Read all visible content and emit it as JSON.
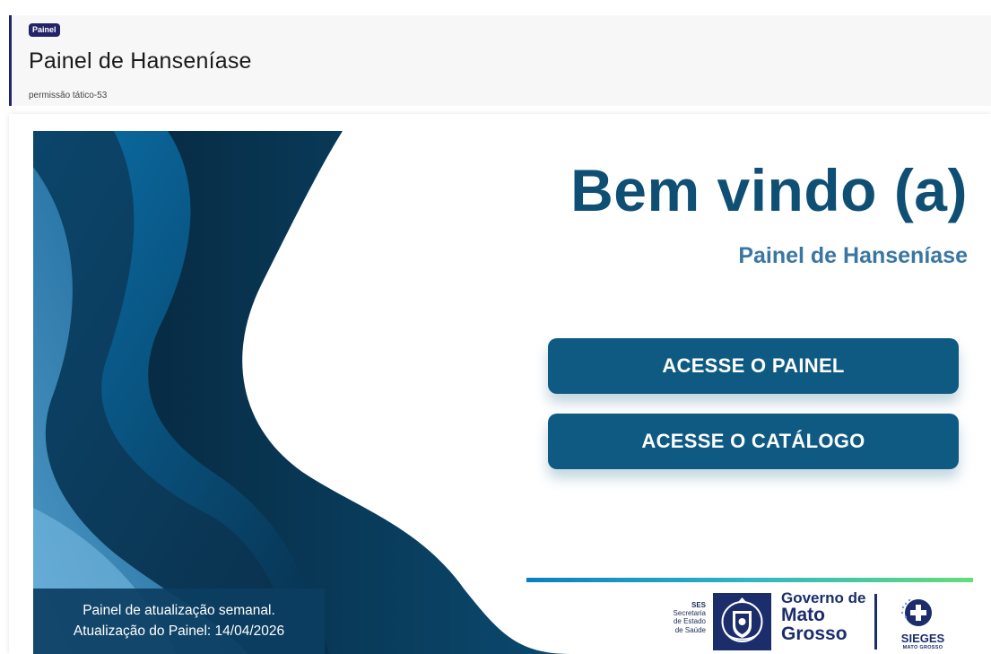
{
  "header": {
    "badge": "Painel",
    "title": "Painel de Hanseníase",
    "subtitle": "permissão tático-53"
  },
  "report": {
    "welcome_title": "Bem vindo (a)",
    "welcome_subtitle": "Painel de Hanseníase",
    "buttons": {
      "panel": "ACESSE O PAINEL",
      "catalog": "ACESSE O CATÁLOGO"
    },
    "info": {
      "line1": "Painel de atualização semanal.",
      "line2": "Atualização do Painel: 14/04/2026"
    },
    "logos": {
      "ses_lines": [
        "SES",
        "Secretaria",
        "de Estado",
        "de Saúde"
      ],
      "gov_lines": [
        "Governo de",
        "Mato",
        "Grosso"
      ],
      "sieges_title": "SIEGES",
      "sieges_sub": "MATO GROSSO"
    }
  },
  "colors": {
    "accent_navy": "#23236a",
    "primary_blue": "#0e5a82",
    "title_blue": "#0e4f73",
    "subtitle_blue": "#3a76a3",
    "gradient_line": [
      "#0b7ec1",
      "#2fb6c5",
      "#63dd7b"
    ]
  }
}
